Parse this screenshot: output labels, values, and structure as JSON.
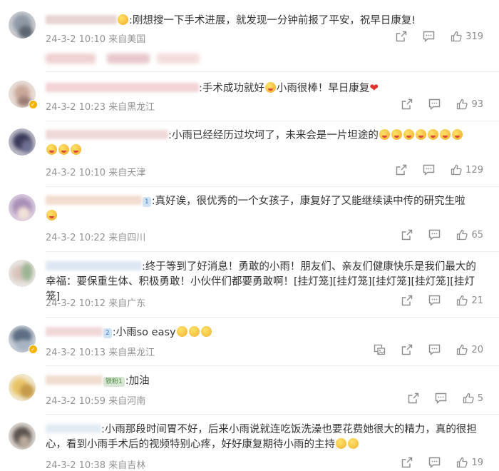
{
  "comments": [
    {
      "text": ":刚想搜一下手术进展，就发现一分钟前报了平安，祝早日康复!",
      "time": "24-3-2 10:10",
      "location": "来自美国",
      "likes": "319"
    },
    {
      "text": ":手术成功就好",
      "text2": "小雨很棒！早日康复",
      "time": "24-3-2 10:23",
      "location": "来自黑龙江",
      "likes": "93"
    },
    {
      "text": ":小雨已经经历过坎坷了，未来会是一片坦途的",
      "time": "24-3-2 10:10",
      "location": "来自天津",
      "likes": "129"
    },
    {
      "badge": "1",
      "text": ":真好诶，很优秀的一个女孩子，康复好了又能继续读中传的研究生啦",
      "time": "24-3-2 10:22",
      "location": "来自四川",
      "likes": "65"
    },
    {
      "text": ":终于等到了好消息！勇敢的小雨！朋友们、亲友们健康快乐是我们最大的",
      "text2": "幸福：要保重生体、积极勇敢！小伙伴们都要勇敢啊！[挂灯笼][挂灯笼][挂灯笼][挂灯笼][挂灯笼]",
      "time": "24-3-2 10:12",
      "location": "来自广东",
      "likes": "21"
    },
    {
      "badge": "2",
      "text": ":小雨so easy",
      "time": "24-3-2 10:13",
      "location": "来自黑龙江",
      "likes": "20"
    },
    {
      "badge": "铁粉1",
      "text": ":加油",
      "time": "24-3-2 10:59",
      "location": "来自河南",
      "likes": "5"
    },
    {
      "text": ":小雨那段时间胃不好，后来小雨说就连吃饭洗澡也要花费她很大的精力，真的很担",
      "text2": "心，看到小雨手术后的视频特别心疼，好好康复期待小雨的主持",
      "time": "24-3-2 10:38",
      "location": "来自吉林",
      "likes": "19"
    }
  ],
  "icons": {
    "forward": "forward-icon",
    "comment": "comment-icon",
    "like": "thumbs-up-icon",
    "image": "image-comment-icon"
  },
  "colors": {
    "text": "#333333",
    "meta": "#939393",
    "fan_badge_bg": "#cfe3f5",
    "fan_badge_text": "#3a7bc8"
  }
}
